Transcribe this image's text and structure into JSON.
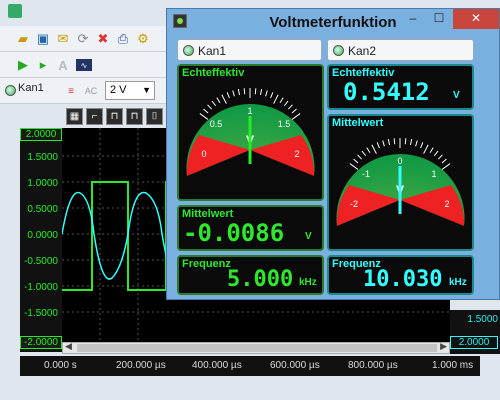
{
  "back": {
    "channel_label": "Kan1",
    "volt_select": "2 V",
    "y_labels": [
      "2.0000",
      "1.5000",
      "1.0000",
      "0.5000",
      "0.0000",
      "-0.5000",
      "-1.0000",
      "-1.5000",
      "-2.0000"
    ],
    "x_labels": [
      "0.000 s",
      "200.000 µs",
      "400.000 µs",
      "600.000 µs",
      "800.000 µs",
      "1.000 ms"
    ],
    "right_labels": [
      "1.5000",
      "2.0000"
    ]
  },
  "window": {
    "title": "Voltmeterfunktion",
    "minimize": "–",
    "maximize": "☐",
    "close": "✕"
  },
  "kan1": {
    "tab_label": "Kan1",
    "echteffektiv_title": "Echteffektiv",
    "gauge_labels": [
      "0",
      "0.5",
      "1",
      "1.5",
      "2"
    ],
    "gauge_value": 1.0,
    "mittelwert_title": "Mittelwert",
    "mittelwert_value": "-0.0086",
    "mittelwert_unit": "V",
    "frequenz_title": "Frequenz",
    "frequenz_value": "5.000",
    "frequenz_unit": "kHz"
  },
  "kan2": {
    "tab_label": "Kan2",
    "echteffektiv_title": "Echteffektiv",
    "echteffektiv_value": "0.5412",
    "echteffektiv_unit": "V",
    "mittelwert_title": "Mittelwert",
    "gauge_labels": [
      "-2",
      "-1",
      "0",
      "1",
      "2"
    ],
    "gauge_value": 0.0,
    "frequenz_title": "Frequenz",
    "frequenz_value": "10.030",
    "frequenz_unit": "kHz"
  },
  "colors": {
    "panel_green": "#2ee82e",
    "panel_cyan": "#33ffff",
    "window_bg": "#7ab0df",
    "close_red": "#c9463d"
  }
}
